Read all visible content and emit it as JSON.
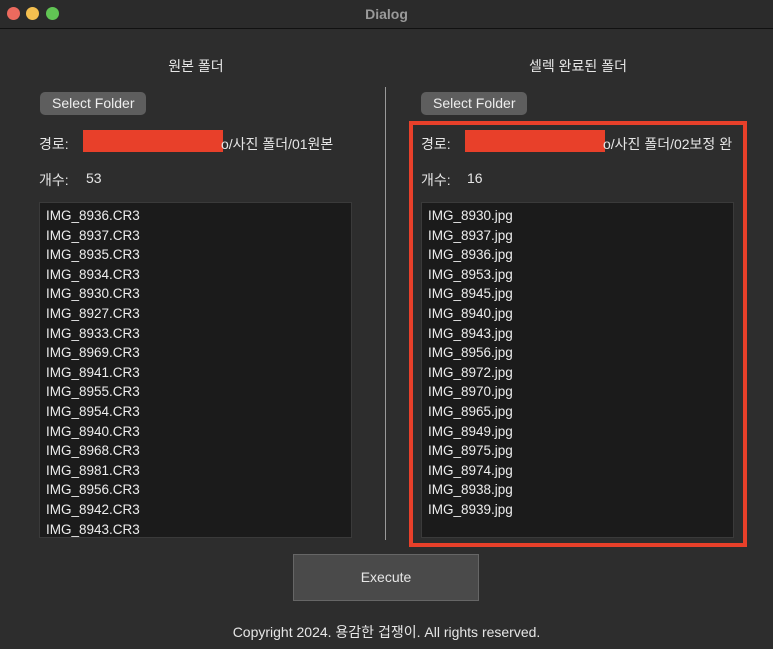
{
  "window": {
    "title": "Dialog"
  },
  "left": {
    "heading": "원본 폴더",
    "select_label": "Select Folder",
    "path_label": "경로:",
    "path_suffix": "o/사진 폴더/01원본",
    "count_label": "개수:",
    "count": "53",
    "files": [
      "IMG_8936.CR3",
      "IMG_8937.CR3",
      "IMG_8935.CR3",
      "IMG_8934.CR3",
      "IMG_8930.CR3",
      "IMG_8927.CR3",
      "IMG_8933.CR3",
      "IMG_8969.CR3",
      "IMG_8941.CR3",
      "IMG_8955.CR3",
      "IMG_8954.CR3",
      "IMG_8940.CR3",
      "IMG_8968.CR3",
      "IMG_8981.CR3",
      "IMG_8956.CR3",
      "IMG_8942.CR3",
      "IMG_8943.CR3"
    ]
  },
  "right": {
    "heading": "셀렉 완료된 폴더",
    "select_label": "Select Folder",
    "path_label": "경로:",
    "path_suffix": "o/사진 폴더/02보정 완",
    "count_label": "개수:",
    "count": "16",
    "files": [
      "IMG_8930.jpg",
      "IMG_8937.jpg",
      "IMG_8936.jpg",
      "IMG_8953.jpg",
      "IMG_8945.jpg",
      "IMG_8940.jpg",
      "IMG_8943.jpg",
      "IMG_8956.jpg",
      "IMG_8972.jpg",
      "IMG_8970.jpg",
      "IMG_8965.jpg",
      "IMG_8949.jpg",
      "IMG_8975.jpg",
      "IMG_8974.jpg",
      "IMG_8938.jpg",
      "IMG_8939.jpg"
    ]
  },
  "execute_label": "Execute",
  "footer": "Copyright 2024. 용감한 겁쟁이. All rights reserved.",
  "colors": {
    "highlight": "#e8402a"
  }
}
